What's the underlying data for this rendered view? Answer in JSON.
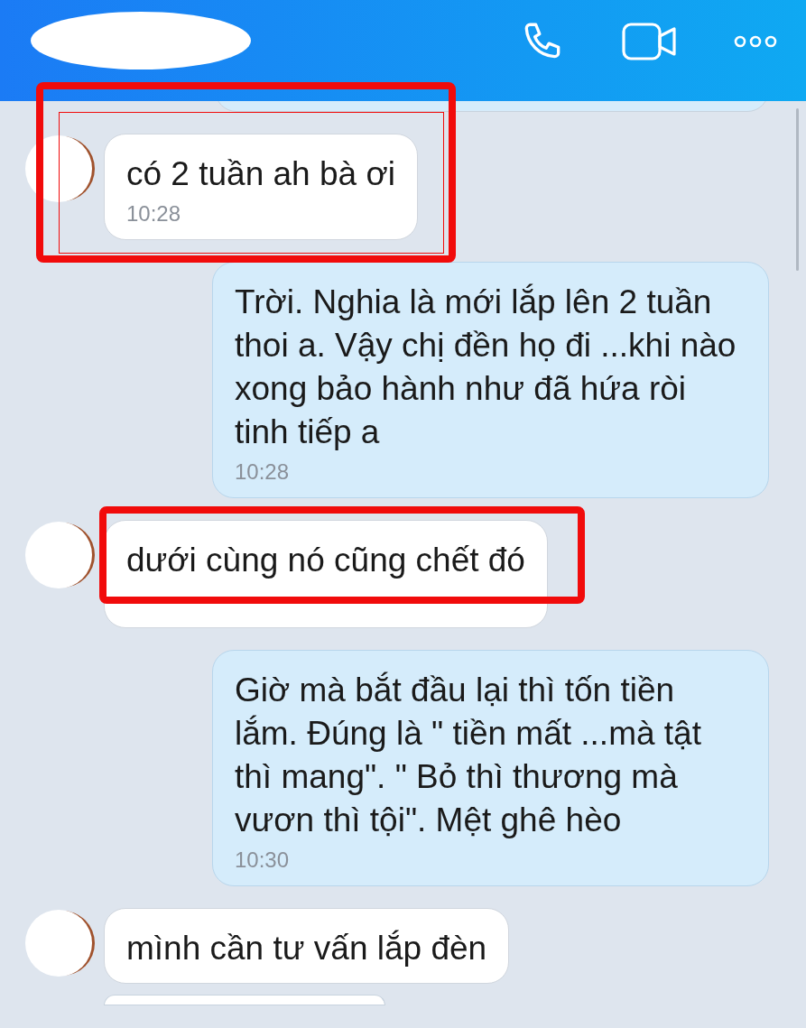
{
  "messages": [
    {
      "kind": "outgoing_peek"
    },
    {
      "kind": "incoming",
      "text": "có 2 tuần ah bà ơi",
      "time": "10:28",
      "boxed": true,
      "double_frame": true
    },
    {
      "kind": "outgoing",
      "text": "Trời. Nghia là mới lắp lên 2 tuần thoi a. Vậy chị đền họ đi ...khi nào xong bảo hành như đã hứa ròi tinh tiếp a",
      "time": "10:28"
    },
    {
      "kind": "incoming",
      "text": "dưới cùng nó cũng chết đó",
      "boxed": true,
      "double_frame": false
    },
    {
      "kind": "outgoing",
      "text": "Giờ mà bắt đầu lại thì tốn tiền lắm. Đúng là \" tiền mất ...mà tật thì mang\". \" Bỏ thì thương mà vươn thì tội\". Mệt ghê hèo",
      "time": "10:30"
    },
    {
      "kind": "incoming",
      "text": "mình cần tư vấn lắp đèn"
    },
    {
      "kind": "incoming_peek"
    }
  ]
}
